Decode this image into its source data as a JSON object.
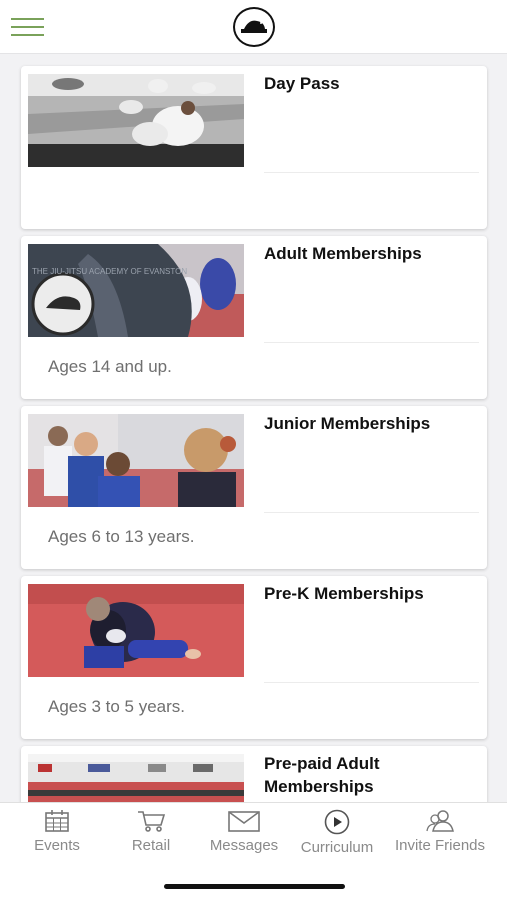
{
  "header": {
    "menu_icon": "hamburger-menu-icon",
    "logo_icon": "bear-logo-icon",
    "accent_color": "#7aa25a"
  },
  "cards": [
    {
      "title": "Day Pass",
      "description": "",
      "image": "jiu-jitsu-class-photo"
    },
    {
      "title": "Adult Memberships",
      "description": "Ages 14 and up.",
      "image": "adult-gi-patch-photo"
    },
    {
      "title": "Junior Memberships",
      "description": "Ages 6 to 13 years.",
      "image": "junior-students-photo"
    },
    {
      "title": "Pre-K Memberships",
      "description": "Ages 3 to 5 years.",
      "image": "pre-k-grappling-photo"
    },
    {
      "title": "Pre-paid Adult Memberships",
      "description": "",
      "image": "academy-mat-room-photo"
    }
  ],
  "tabbar": {
    "tabs": [
      {
        "label": "Events",
        "icon": "calendar-icon"
      },
      {
        "label": "Retail",
        "icon": "cart-icon"
      },
      {
        "label": "Messages",
        "icon": "envelope-icon"
      },
      {
        "label": "Curriculum",
        "icon": "play-circle-icon"
      },
      {
        "label": "Invite Friends",
        "icon": "people-icon"
      }
    ]
  }
}
